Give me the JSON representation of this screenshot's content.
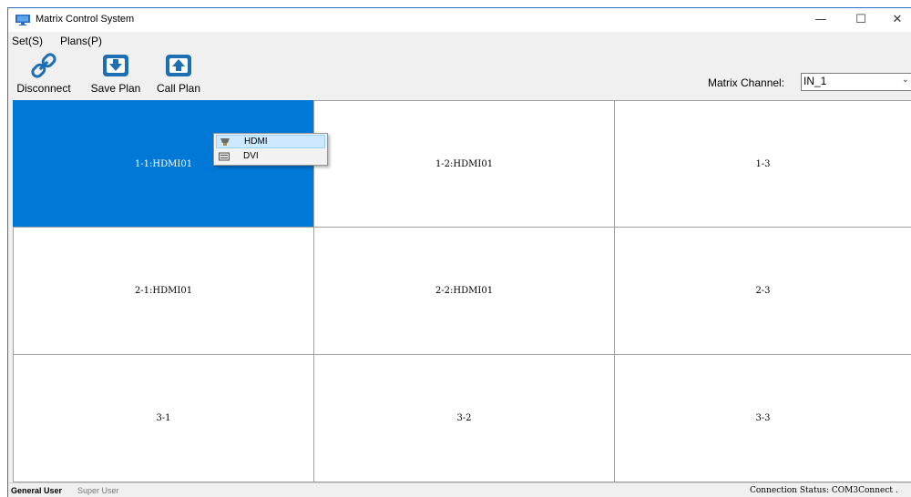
{
  "window": {
    "title": "Matrix Control System",
    "min_glyph": "—",
    "max_glyph": "☐",
    "close_glyph": "✕"
  },
  "menu": {
    "set": "Set(S)",
    "plans": "Plans(P)"
  },
  "toolbar": {
    "disconnect": "Disconnect",
    "save_plan": "Save Plan",
    "call_plan": "Call Plan",
    "icons": [
      "link-icon",
      "save-plan-icon",
      "call-plan-icon"
    ]
  },
  "channel": {
    "label": "Matrix Channel:",
    "value": "IN_1",
    "arrow": "⌄"
  },
  "grid": {
    "cells": [
      [
        "1-1:HDMI01",
        "1-2:HDMI01",
        "1-3"
      ],
      [
        "2-1:HDMI01",
        "2-2:HDMI01",
        "2-3"
      ],
      [
        "3-1",
        "3-2",
        "3-3"
      ]
    ],
    "selected": "1-1:HDMI01"
  },
  "context_menu": {
    "items": [
      "HDMI",
      "DVI"
    ],
    "highlighted": "HDMI"
  },
  "status": {
    "general_user": "General User",
    "super_user": "Super User",
    "connection": "Connection Status:  COM3Connect ."
  },
  "colors": {
    "selection": "#0078d7",
    "title_accent": "#2b6cc4",
    "icon_blue": "#1c6fb3"
  }
}
